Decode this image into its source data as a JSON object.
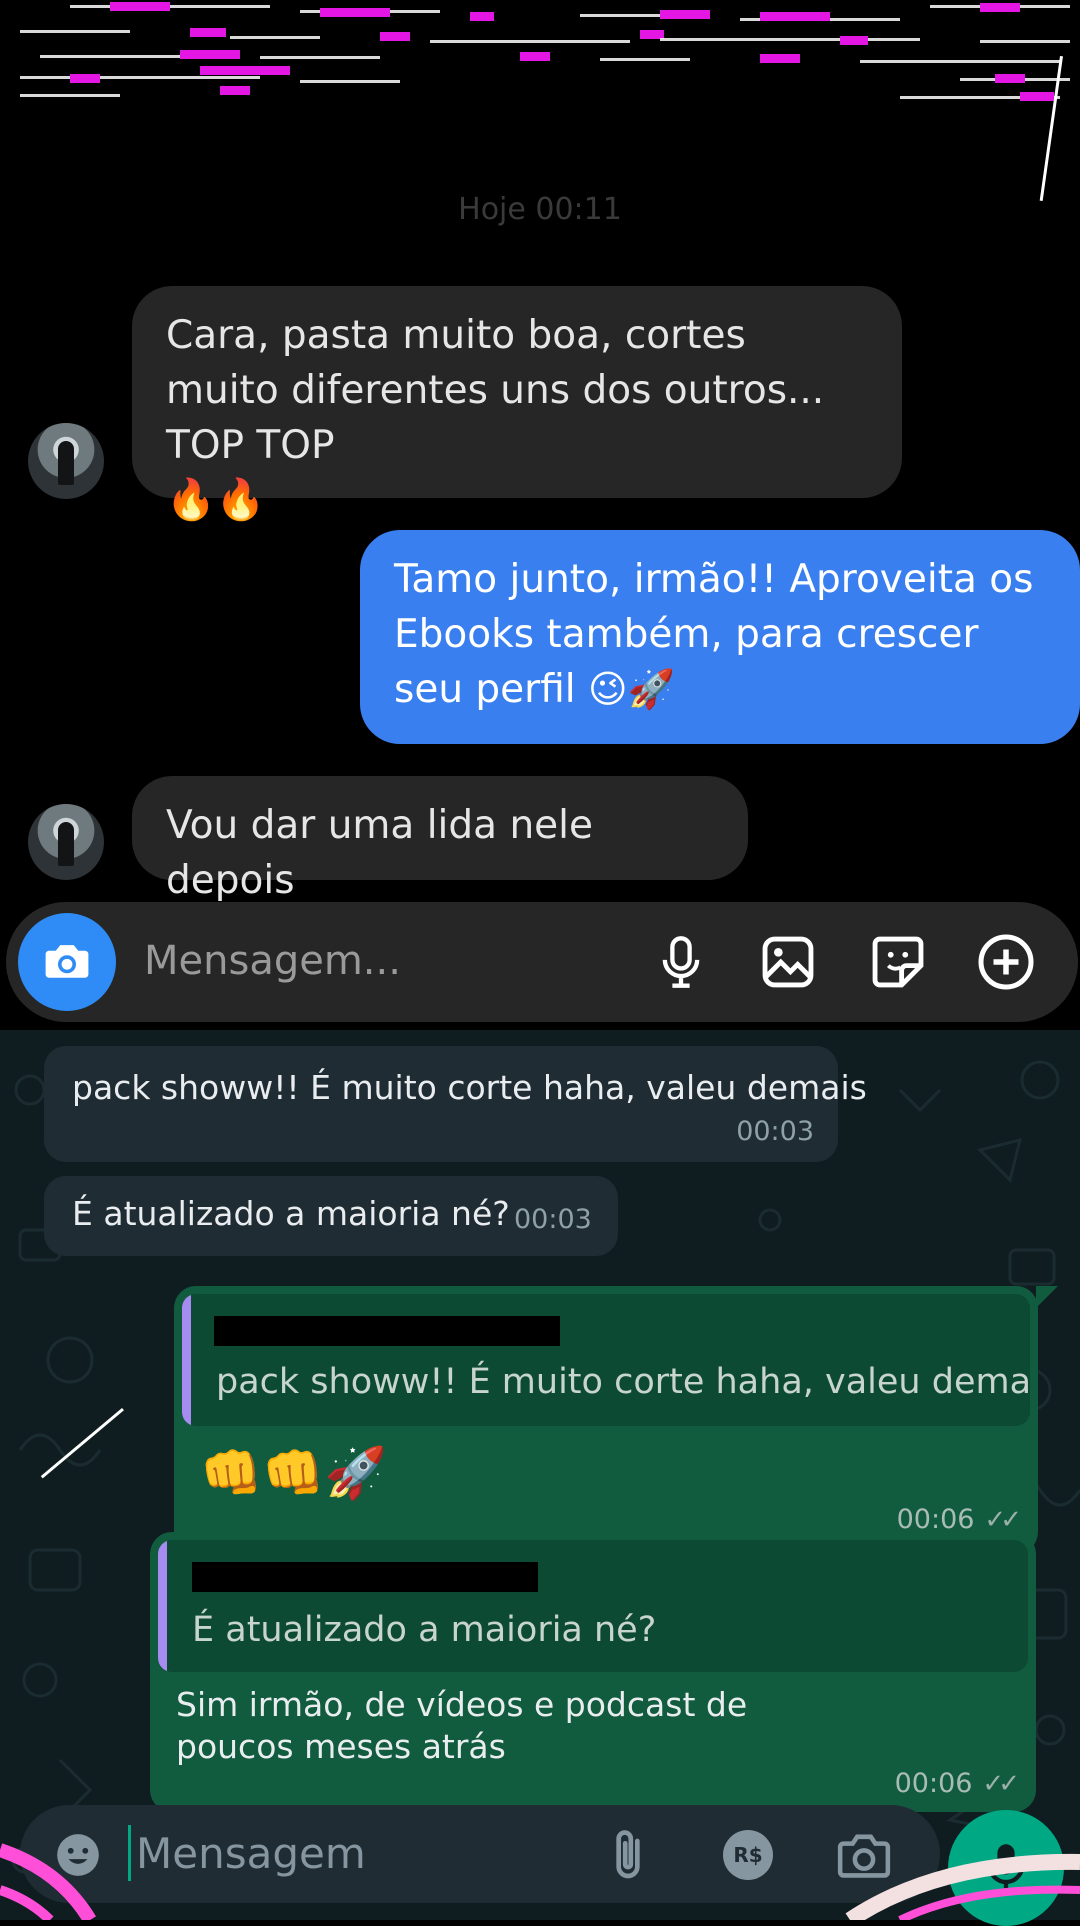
{
  "instagram": {
    "timestamp": "Hoje 00:11",
    "messages": [
      {
        "side": "in",
        "text": "Cara, pasta muito boa, cortes muito diferentes uns dos outros... TOP TOP",
        "emoji": "🔥🔥"
      },
      {
        "side": "out",
        "text": "Tamo junto, irmão!! Aproveita os Ebooks também, para crescer seu perfil",
        "emoji": "😉🚀"
      },
      {
        "side": "in",
        "text": "Vou dar uma lida nele depois"
      }
    ],
    "composer": {
      "placeholder": "Mensagem...",
      "icons": [
        "camera-icon",
        "microphone-icon",
        "gallery-icon",
        "sticker-icon",
        "plus-icon"
      ]
    }
  },
  "whatsapp": {
    "messages": [
      {
        "side": "in",
        "text": "pack showw!! É muito corte haha, valeu demais",
        "time": "00:03"
      },
      {
        "side": "in",
        "text": "É atualizado a maioria né?",
        "time": "00:03"
      },
      {
        "side": "out",
        "quote": "pack showw!! É muito corte haha, valeu demais",
        "text": "👊👊🚀",
        "time": "00:06",
        "status": "read"
      },
      {
        "side": "out",
        "quote": "É atualizado a maioria né?",
        "text": "Sim irmão, de vídeos e podcast  de poucos meses atrás",
        "time": "00:06",
        "status": "read"
      }
    ],
    "composer": {
      "placeholder": "Mensagem",
      "currency_label": "R$",
      "icons": [
        "emoji-icon",
        "attach-icon",
        "payment-icon",
        "camera-icon",
        "microphone-icon"
      ]
    },
    "colors": {
      "background": "#0f1d21",
      "incoming": "#1f2c33",
      "outgoing": "#115c3f",
      "accent": "#00a884",
      "quote_bar": "#a68cf0"
    }
  },
  "overlay": {
    "glitch_color": "#e316e3",
    "arc_color": "#ff4fd8"
  }
}
